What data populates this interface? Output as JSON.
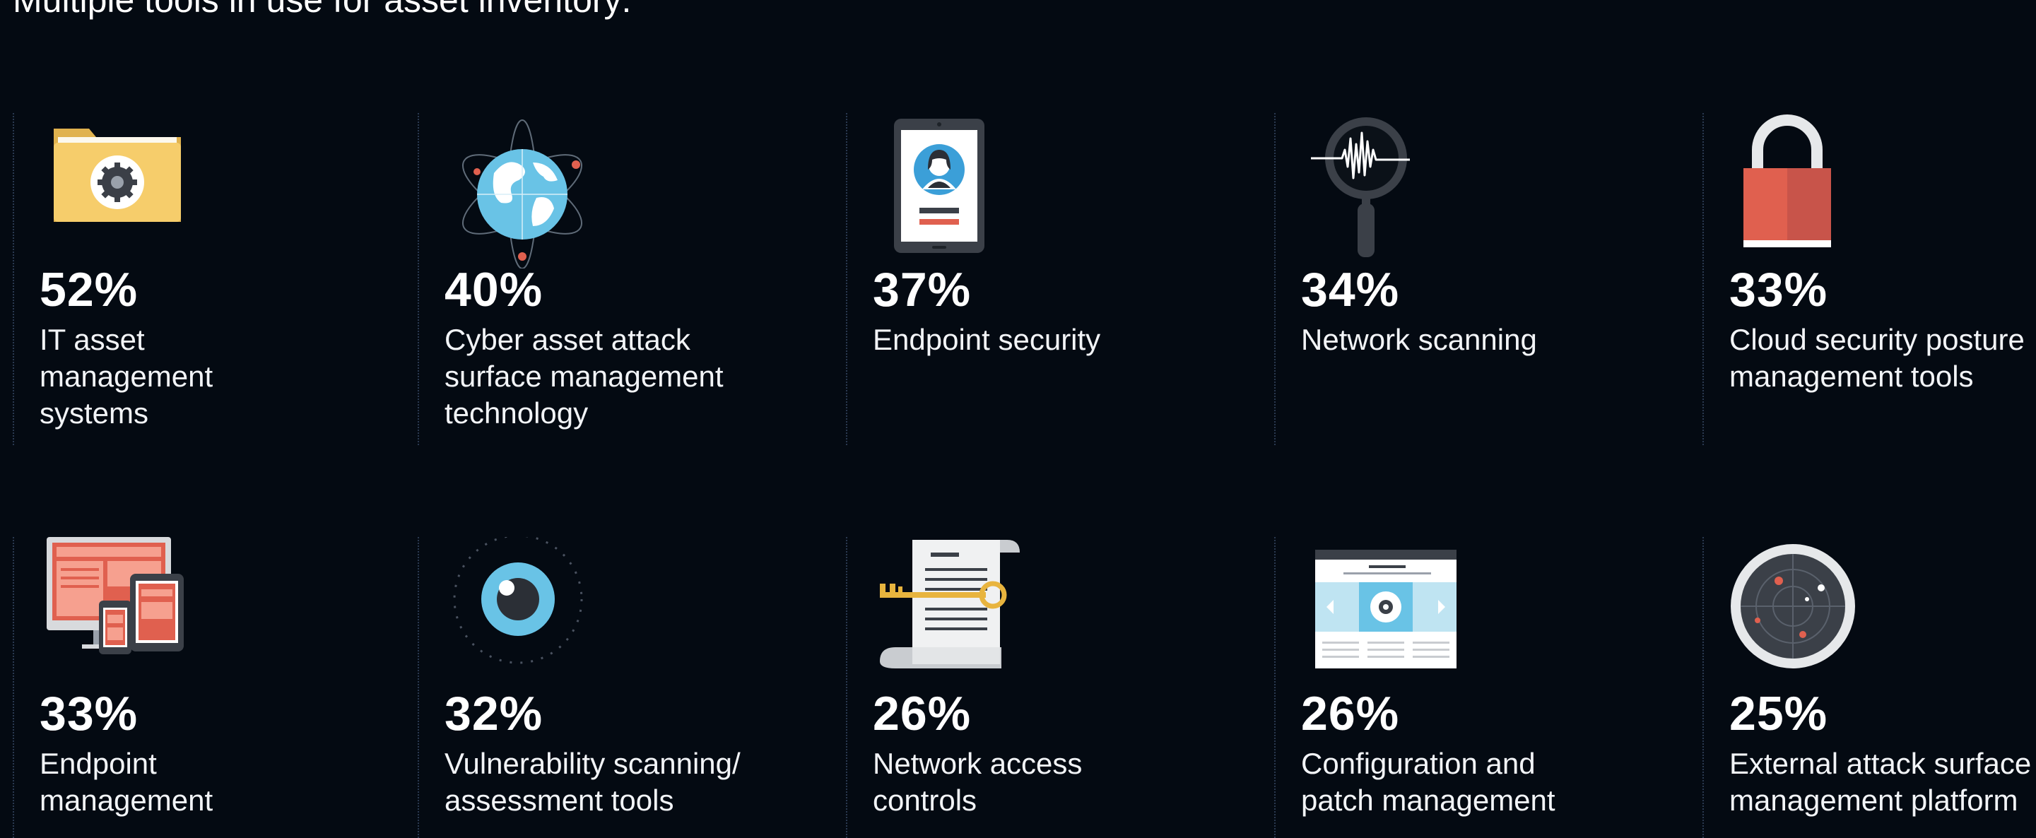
{
  "title": "Multiple tools in use for asset inventory:",
  "items": [
    {
      "value": "52%",
      "label_lines": [
        "IT asset",
        "management",
        "systems"
      ],
      "icon": "folder-gear-icon"
    },
    {
      "value": "40%",
      "label_lines": [
        "Cyber asset attack",
        "surface management",
        "technology"
      ],
      "icon": "globe-orbit-icon"
    },
    {
      "value": "37%",
      "label_lines": [
        "Endpoint security"
      ],
      "icon": "tablet-profile-icon"
    },
    {
      "value": "34%",
      "label_lines": [
        "Network scanning"
      ],
      "icon": "magnifier-waveform-icon"
    },
    {
      "value": "33%",
      "label_lines": [
        "Cloud security posture",
        "management tools"
      ],
      "icon": "padlock-icon"
    },
    {
      "value": "33%",
      "label_lines": [
        "Endpoint",
        "management"
      ],
      "icon": "devices-icon"
    },
    {
      "value": "32%",
      "label_lines": [
        "Vulnerability scanning/",
        "assessment tools"
      ],
      "icon": "eye-icon"
    },
    {
      "value": "26%",
      "label_lines": [
        "Network access",
        "controls"
      ],
      "icon": "key-scroll-icon"
    },
    {
      "value": "26%",
      "label_lines": [
        "Configuration and",
        "patch management"
      ],
      "icon": "browser-gear-icon"
    },
    {
      "value": "25%",
      "label_lines": [
        "External attack surface",
        "management platform"
      ],
      "icon": "radar-icon"
    }
  ],
  "colors": {
    "background": "#040a12",
    "folder": "#f6cd6b",
    "globe": "#69c3e6",
    "accent_red": "#e0604f",
    "divider": "#2a3950"
  }
}
